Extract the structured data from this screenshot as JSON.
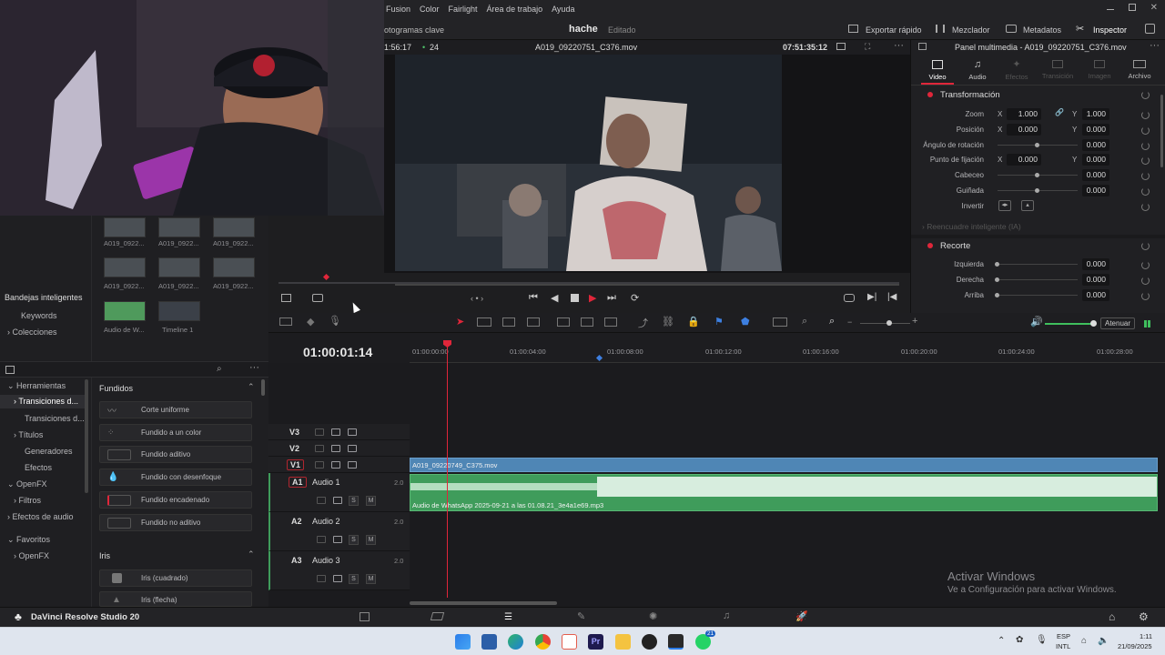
{
  "menu": [
    "Fusion",
    "Color",
    "Fairlight",
    "Área de trabajo",
    "Ayuda"
  ],
  "tabs": {
    "project": "hache",
    "state": "Editado",
    "keyframes": "otogramas clave",
    "quick_export": "Exportar rápido",
    "mixer": "Mezclador",
    "metadata": "Metadatos",
    "inspector": "Inspector"
  },
  "viewer": {
    "timecode_left": "1:56:17",
    "fps": "24",
    "clip_name": "A019_09220751_C376.mov",
    "timecode_right": "07:51:35:12"
  },
  "inspector": {
    "title": "Panel multimedia - A019_09220751_C376.mov",
    "tabs": [
      "Video",
      "Audio",
      "Efectos",
      "Transición",
      "Imagen",
      "Archivo"
    ],
    "transform": {
      "title": "Transformación",
      "zoom_label": "Zoom",
      "zoom_x": "1.000",
      "zoom_y": "1.000",
      "position_label": "Posición",
      "pos_x": "0.000",
      "pos_y": "0.000",
      "rotation_label": "Ángulo de rotación",
      "rotation": "0.000",
      "anchor_label": "Punto de fijación",
      "anchor_x": "0.000",
      "anchor_y": "0.000",
      "pitch_label": "Cabeceo",
      "pitch": "0.000",
      "yaw_label": "Guiñada",
      "yaw": "0.000",
      "flip_label": "Invertir"
    },
    "smart_reframe": "Reencuadre inteligente (IA)",
    "crop": {
      "title": "Recorte",
      "left_label": "Izquierda",
      "left": "0.000",
      "right_label": "Derecha",
      "right": "0.000",
      "top_label": "Arriba",
      "top": "0.000"
    },
    "x": "X",
    "y": "Y"
  },
  "media_pool": {
    "clips": [
      "A019_0922...",
      "A019_0922...",
      "A019_0922...",
      "A019_0922...",
      "A019_0922...",
      "A019_0922...",
      "Audio de W...",
      "Timeline 1"
    ],
    "smart_bins": "Bandejas inteligentes",
    "keywords": "Keywords",
    "collections": "Colecciones"
  },
  "effects": {
    "tree": [
      "Herramientas",
      "Transiciones d...",
      "Transiciones d...",
      "Títulos",
      "Generadores",
      "Efectos",
      "OpenFX",
      "Filtros",
      "Efectos de audio",
      "Favoritos",
      "OpenFX"
    ],
    "section_fades": "Fundidos",
    "fades": [
      "Corte uniforme",
      "Fundido a un color",
      "Fundido aditivo",
      "Fundido con desenfoque",
      "Fundido encadenado",
      "Fundido no aditivo"
    ],
    "section_iris": "Iris",
    "iris": [
      "Iris (cuadrado)",
      "Iris (flecha)"
    ]
  },
  "timeline": {
    "timecode": "01:00:01:14",
    "ruler": [
      "01:00:00:00",
      "01:00:04:00",
      "01:00:08:00",
      "01:00:12:00",
      "01:00:16:00",
      "01:00:20:00",
      "01:00:24:00",
      "01:00:28:00"
    ],
    "tracks_video": [
      "V3",
      "V2",
      "V1"
    ],
    "tracks_audio": [
      {
        "id": "A1",
        "name": "Audio 1",
        "level": "2.0"
      },
      {
        "id": "A2",
        "name": "Audio 2",
        "level": "2.0"
      },
      {
        "id": "A3",
        "name": "Audio 3",
        "level": "2.0"
      }
    ],
    "video_clip": "A019_09220749_C375.mov",
    "audio_clip": "Audio de WhatsApp 2025-09-21 a las 01.08.21_3e4a1e69.mp3",
    "mute_btn": "Atenuar",
    "s": "S",
    "m": "M"
  },
  "status": {
    "app": "DaVinci Resolve Studio 20"
  },
  "watermark": {
    "line1": "Activar Windows",
    "line2": "Ve a Configuración para activar Windows."
  },
  "taskbar": {
    "lang1": "ESP",
    "lang2": "INTL",
    "time": "1:11",
    "date": "21/09/2025",
    "badge": "21"
  },
  "colors": {
    "accent_red": "#e0263a",
    "video_clip": "#4f86b5",
    "audio_clip": "#3f9c5b",
    "playhead": "#e0263a"
  }
}
